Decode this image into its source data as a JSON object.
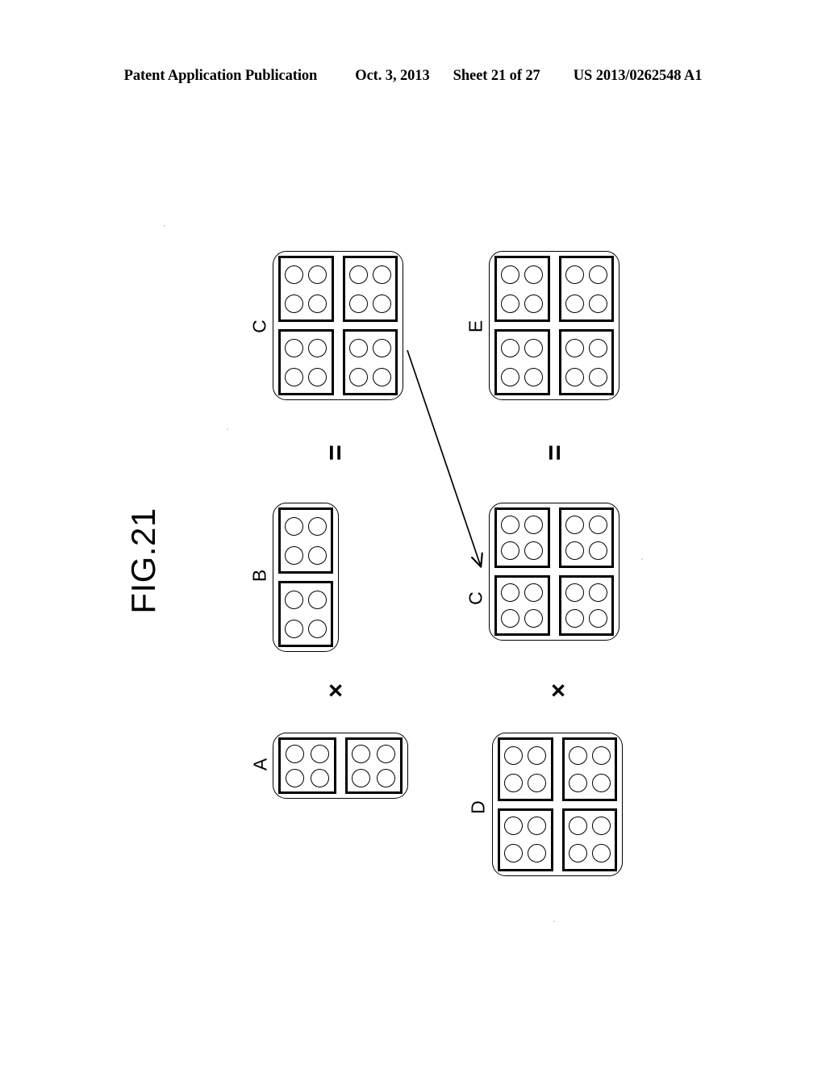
{
  "header": {
    "publication": "Patent Application Publication",
    "date": "Oct. 3, 2013",
    "sheet": "Sheet 21 of 27",
    "patent_number": "US 2013/0262548 A1"
  },
  "figure": {
    "label": "FIG.21",
    "orientation": "rotated-90-ccw",
    "caption": ""
  },
  "operators": {
    "equals": "=",
    "times": "×"
  },
  "blocks": [
    {
      "id": "block-c-top-left",
      "label": "C",
      "columns": 2,
      "rows": 2,
      "cells": 4,
      "dots_per_cell": 4,
      "role": "result-upper-left"
    },
    {
      "id": "block-b",
      "label": "B",
      "columns": 1,
      "rows": 2,
      "cells": 2,
      "dots_per_cell": 4,
      "role": "operand-upper-right"
    },
    {
      "id": "block-a",
      "label": "A",
      "columns": 2,
      "rows": 1,
      "cells": 2,
      "dots_per_cell": 4,
      "role": "operand-upper-left"
    },
    {
      "id": "block-e",
      "label": "E",
      "columns": 2,
      "rows": 2,
      "cells": 4,
      "dots_per_cell": 4,
      "role": "result-lower-left"
    },
    {
      "id": "block-c-bottom-right",
      "label": "C",
      "columns": 2,
      "rows": 2,
      "cells": 4,
      "dots_per_cell": 4,
      "role": "operand-lower-right"
    },
    {
      "id": "block-d",
      "label": "D",
      "columns": 2,
      "rows": 2,
      "cells": 4,
      "dots_per_cell": 4,
      "role": "operand-lower-left"
    }
  ],
  "equations": [
    {
      "id": "equation-top",
      "expression": "C = A × B"
    },
    {
      "id": "equation-bottom",
      "expression": "E = D × C"
    }
  ],
  "annotations": {
    "arrow": {
      "name": "c-reuse-arrow",
      "from_block": "block-c-top-left",
      "to_block": "block-c-bottom-right",
      "description": "arrow"
    }
  },
  "colors": {
    "ink": "#000000",
    "paper": "#ffffff"
  }
}
